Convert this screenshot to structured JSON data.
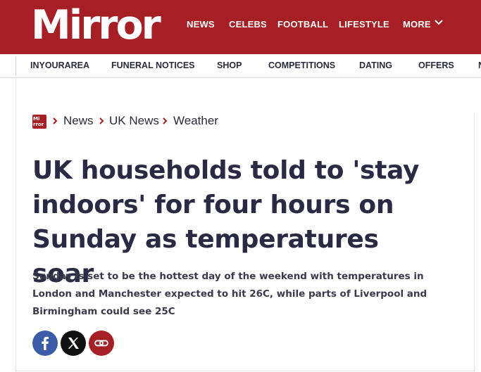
{
  "header": {
    "logo": "Mirror",
    "nav": [
      "NEWS",
      "CELEBS",
      "FOOTBALL",
      "LIFESTYLE",
      "MORE"
    ],
    "brand_color": "#a61f24"
  },
  "subnav": {
    "items": [
      "INYOURAREA",
      "FUNERAL NOTICES",
      "SHOP",
      "COMPETITIONS",
      "DATING",
      "OFFERS",
      "N"
    ]
  },
  "breadcrumb": {
    "logo_icon": "mirror-logo-icon",
    "items": [
      "News",
      "UK News",
      "Weather"
    ]
  },
  "article": {
    "headline": "UK households told to 'stay indoors' for four hours on Sunday as temperatures soar",
    "standfirst": "Sunday is set to be the hottest day of the weekend with temperatures in London and Manchester expected to hit 26C, while parts of Liverpool and Birmingham could see 25C"
  },
  "share": {
    "icons": [
      "facebook-icon",
      "x-icon",
      "link-icon"
    ],
    "colors": {
      "facebook": "#3b5ca8",
      "x": "#111111",
      "link": "#a61f24"
    }
  }
}
